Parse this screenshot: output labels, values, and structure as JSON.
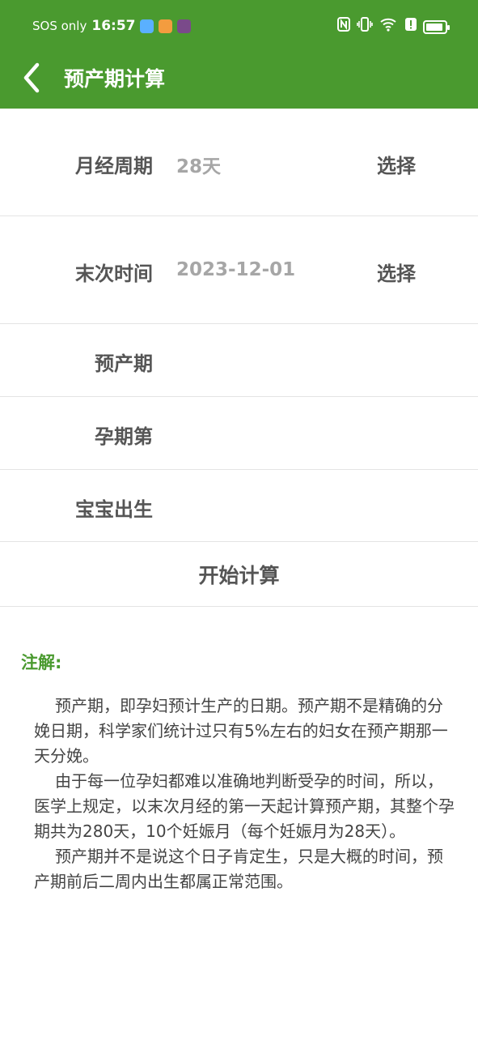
{
  "status_bar": {
    "carrier": "SOS only",
    "time": "16:57",
    "right_icons": [
      "nfc-icon",
      "vibrate-icon",
      "wifi-icon",
      "alert-icon",
      "battery-icon"
    ]
  },
  "header": {
    "title": "预产期计算",
    "back_icon": "chevron-left-icon"
  },
  "form": {
    "cycle": {
      "label": "月经周期",
      "value": "28天",
      "action": "选择"
    },
    "last_period": {
      "label": "末次时间",
      "value": "2023-12-01",
      "action": "选择"
    },
    "due_date": {
      "label": "预产期"
    },
    "week": {
      "label": "孕期第"
    },
    "birth": {
      "label": "宝宝出生"
    },
    "calculate_label": "开始计算"
  },
  "notes": {
    "title": "注解:",
    "paragraphs": [
      "预产期，即孕妇预计生产的日期。预产期不是精确的分娩日期，科学家们统计过只有5%左右的妇女在预产期那一天分娩。",
      "由于每一位孕妇都难以准确地判断受孕的时间，所以，医学上规定，以末次月经的第一天起计算预产期，其整个孕期共为280天，10个妊娠月（每个妊娠月为28天）。",
      "预产期并不是说这个日子肯定生，只是大概的时间，预产期前后二周内出生都属正常范围。"
    ]
  },
  "colors": {
    "primary": "#4a9a2f",
    "text": "#555555",
    "muted": "#a6a6a6"
  }
}
